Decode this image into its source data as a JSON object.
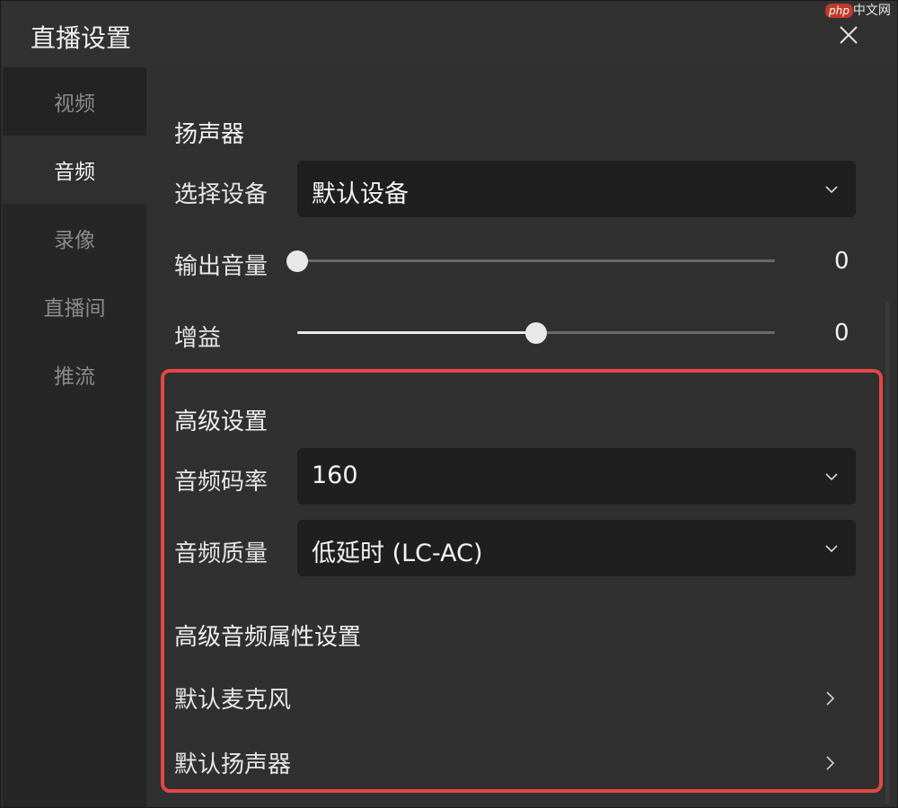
{
  "window": {
    "title": "直播设置"
  },
  "watermark": {
    "badge": "php",
    "text": "中文网"
  },
  "sidebar": {
    "items": [
      {
        "label": "视频"
      },
      {
        "label": "音频"
      },
      {
        "label": "录像"
      },
      {
        "label": "直播间"
      },
      {
        "label": "推流"
      }
    ],
    "active_index": 1
  },
  "speaker": {
    "title": "扬声器",
    "device_label": "选择设备",
    "device_value": "默认设备",
    "volume_label": "输出音量",
    "volume_value": "0",
    "volume_level": 0,
    "gain_label": "增益",
    "gain_value": "0",
    "gain_level": 0.5
  },
  "advanced": {
    "title": "高级设置",
    "bitrate_label": "音频码率",
    "bitrate_value": "160",
    "quality_label": "音频质量",
    "quality_value": "低延时 (LC-AC)",
    "props_title": "高级音频属性设置",
    "links": [
      {
        "label": "默认麦克风"
      },
      {
        "label": "默认扬声器"
      }
    ]
  },
  "colors": {
    "highlight": "#e64646",
    "accent": "#e9e9e9"
  }
}
